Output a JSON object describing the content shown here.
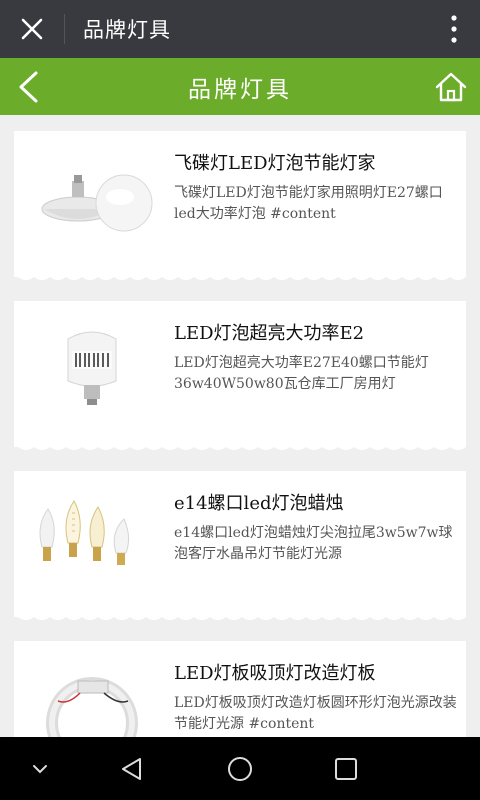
{
  "topbar": {
    "title": "品牌灯具",
    "close_icon": "close-icon",
    "more_icon": "more-vertical-icon"
  },
  "header": {
    "title": "品牌灯具",
    "back_icon": "chevron-left-icon",
    "home_icon": "home-icon",
    "color": "#6bad2a"
  },
  "products": [
    {
      "title": "飞碟灯LED灯泡节能灯家",
      "desc": "飞碟灯LED灯泡节能灯家用照明灯E27螺口led大功率灯泡 #content"
    },
    {
      "title": "LED灯泡超亮大功率E2",
      "desc": "LED灯泡超亮大功率E27E40螺口节能灯36w40W50w80瓦仓库工厂房用灯"
    },
    {
      "title": "e14螺口led灯泡蜡烛",
      "desc": "e14螺口led灯泡蜡烛灯尖泡拉尾3w5w7w球泡客厅水晶吊灯节能灯光源"
    },
    {
      "title": "LED灯板吸顶灯改造灯板",
      "desc": "LED灯板吸顶灯改造灯板圆环形灯泡光源改装节能灯光源 #content"
    }
  ],
  "navbar": {
    "icons": [
      "chevron-down-icon",
      "back-triangle-icon",
      "home-circle-icon",
      "recents-square-icon"
    ]
  }
}
